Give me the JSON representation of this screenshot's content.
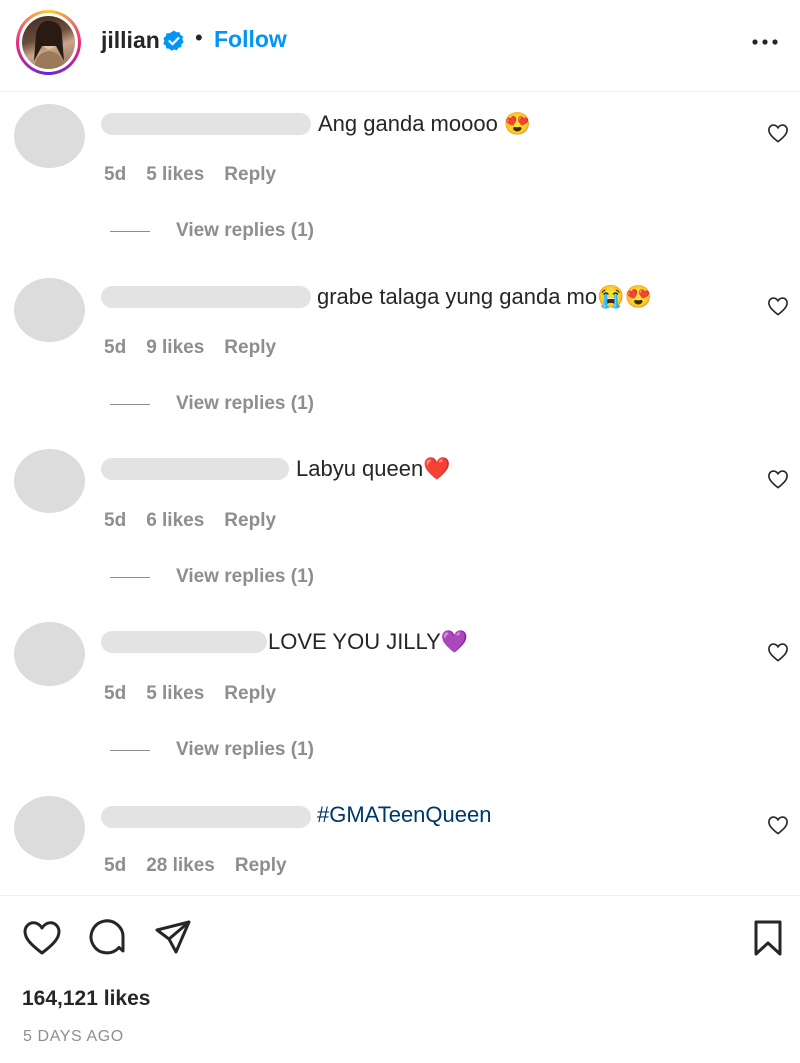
{
  "header": {
    "username": "jillian",
    "separator": "•",
    "follow_label": "Follow",
    "avatar_icon": "profile-photo",
    "verified_icon": "verified-badge-icon",
    "more_icon": "more-horizontal-icon",
    "accent_color": "#0095f6"
  },
  "comments": [
    {
      "text": "Ang ganda moooo 😍",
      "age": "5d",
      "likes": "5 likes",
      "reply": "Reply",
      "view_replies": "View replies (1)"
    },
    {
      "text": "grabe talaga yung ganda mo😭😍",
      "age": "5d",
      "likes": "9 likes",
      "reply": "Reply",
      "view_replies": "View replies (1)"
    },
    {
      "text": "Labyu queen❤️",
      "age": "5d",
      "likes": "6 likes",
      "reply": "Reply",
      "view_replies": "View replies (1)"
    },
    {
      "text": "LOVE YOU JILLY💜",
      "age": "5d",
      "likes": "5 likes",
      "reply": "Reply",
      "view_replies": "View replies (1)"
    },
    {
      "text": "#GMATeenQueen",
      "age": "5d",
      "likes": "28 likes",
      "reply": "Reply"
    }
  ],
  "footer": {
    "likes": "164,121 likes",
    "time_ago": "5 DAYS AGO",
    "icons": [
      "heart-icon",
      "comment-icon",
      "share-icon",
      "bookmark-icon"
    ]
  }
}
